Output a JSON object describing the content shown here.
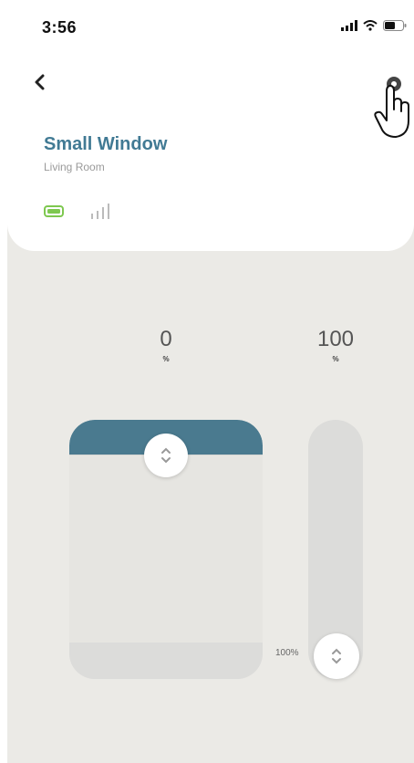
{
  "status": {
    "time": "3:56"
  },
  "device": {
    "name": "Small Window",
    "room": "Living Room"
  },
  "controls": {
    "tilt": {
      "value": "0",
      "unit": "%"
    },
    "position": {
      "value": "100",
      "unit": "%",
      "slider_label": "100%",
      "level_fraction": 1.0
    }
  },
  "colors": {
    "accent": "#417a94",
    "blind": "#4a7a8f",
    "battery": "#7ec850",
    "background": "#ebeae6"
  },
  "icons": [
    "back-icon",
    "gear-icon",
    "hand-cursor-icon",
    "battery-icon",
    "signal-icon",
    "wifi-icon",
    "chevron-up-down-icon"
  ]
}
